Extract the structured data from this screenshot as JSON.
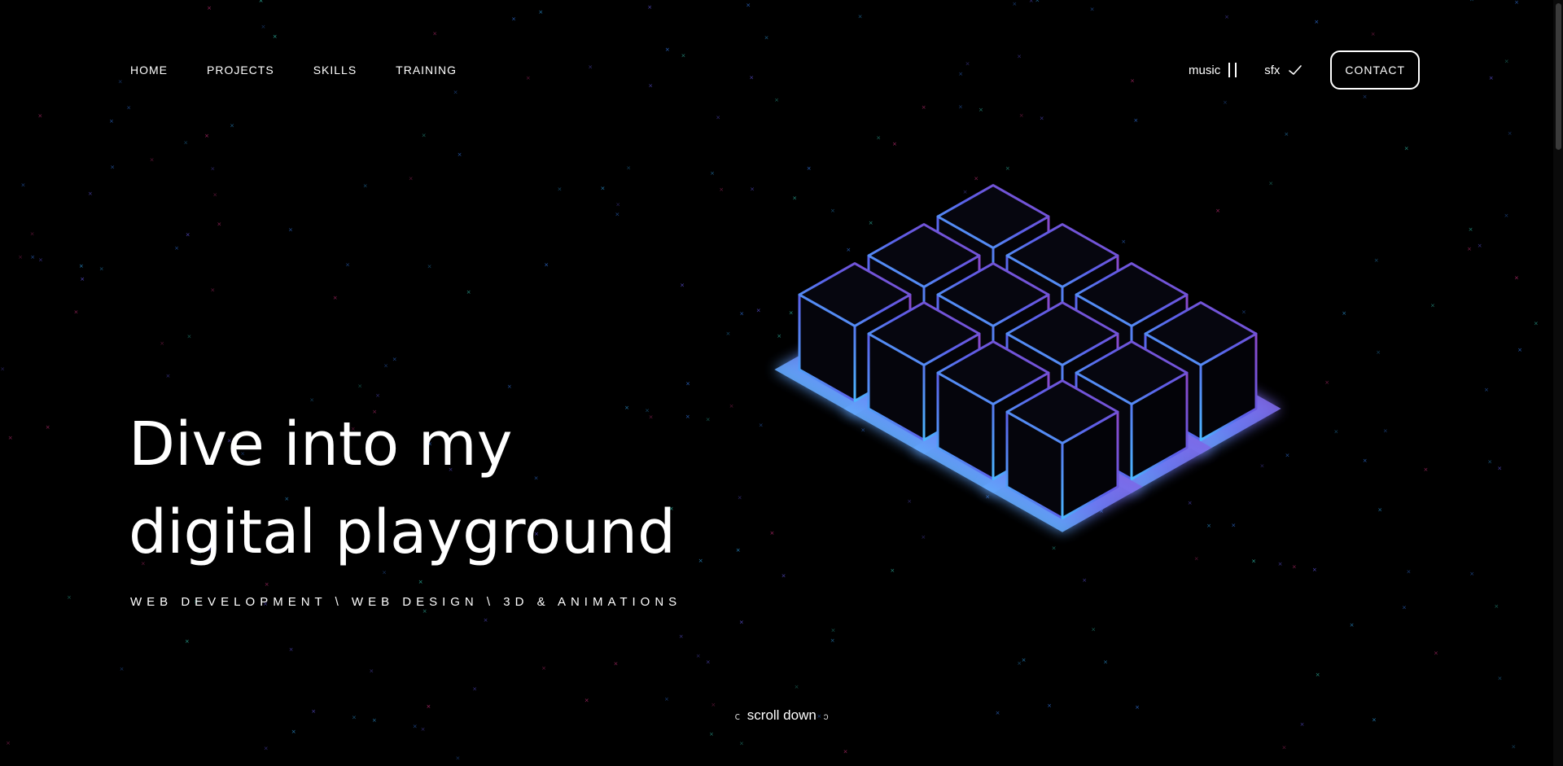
{
  "nav": {
    "items": [
      "HOME",
      "PROJECTS",
      "SKILLS",
      "TRAINING"
    ]
  },
  "controls": {
    "music_label": "music",
    "music_icon": "pause-icon",
    "sfx_label": "sfx",
    "sfx_icon": "check-icon",
    "contact_label": "CONTACT"
  },
  "hero": {
    "title_line1": "Dive into my",
    "title_line2": "digital playground",
    "subtitle": "WEB DEVELOPMENT \\ WEB DESIGN \\ 3D & ANIMATIONS"
  },
  "scroll": {
    "label": "scroll down",
    "brace_left": "ⅽ",
    "brace_right": "ɔ"
  },
  "colors": {
    "background": "#000000",
    "text": "#ffffff",
    "cube_blue": "#4fb6ff",
    "cube_indigo": "#5b6cf0",
    "cube_purple": "#8a4fd8"
  }
}
